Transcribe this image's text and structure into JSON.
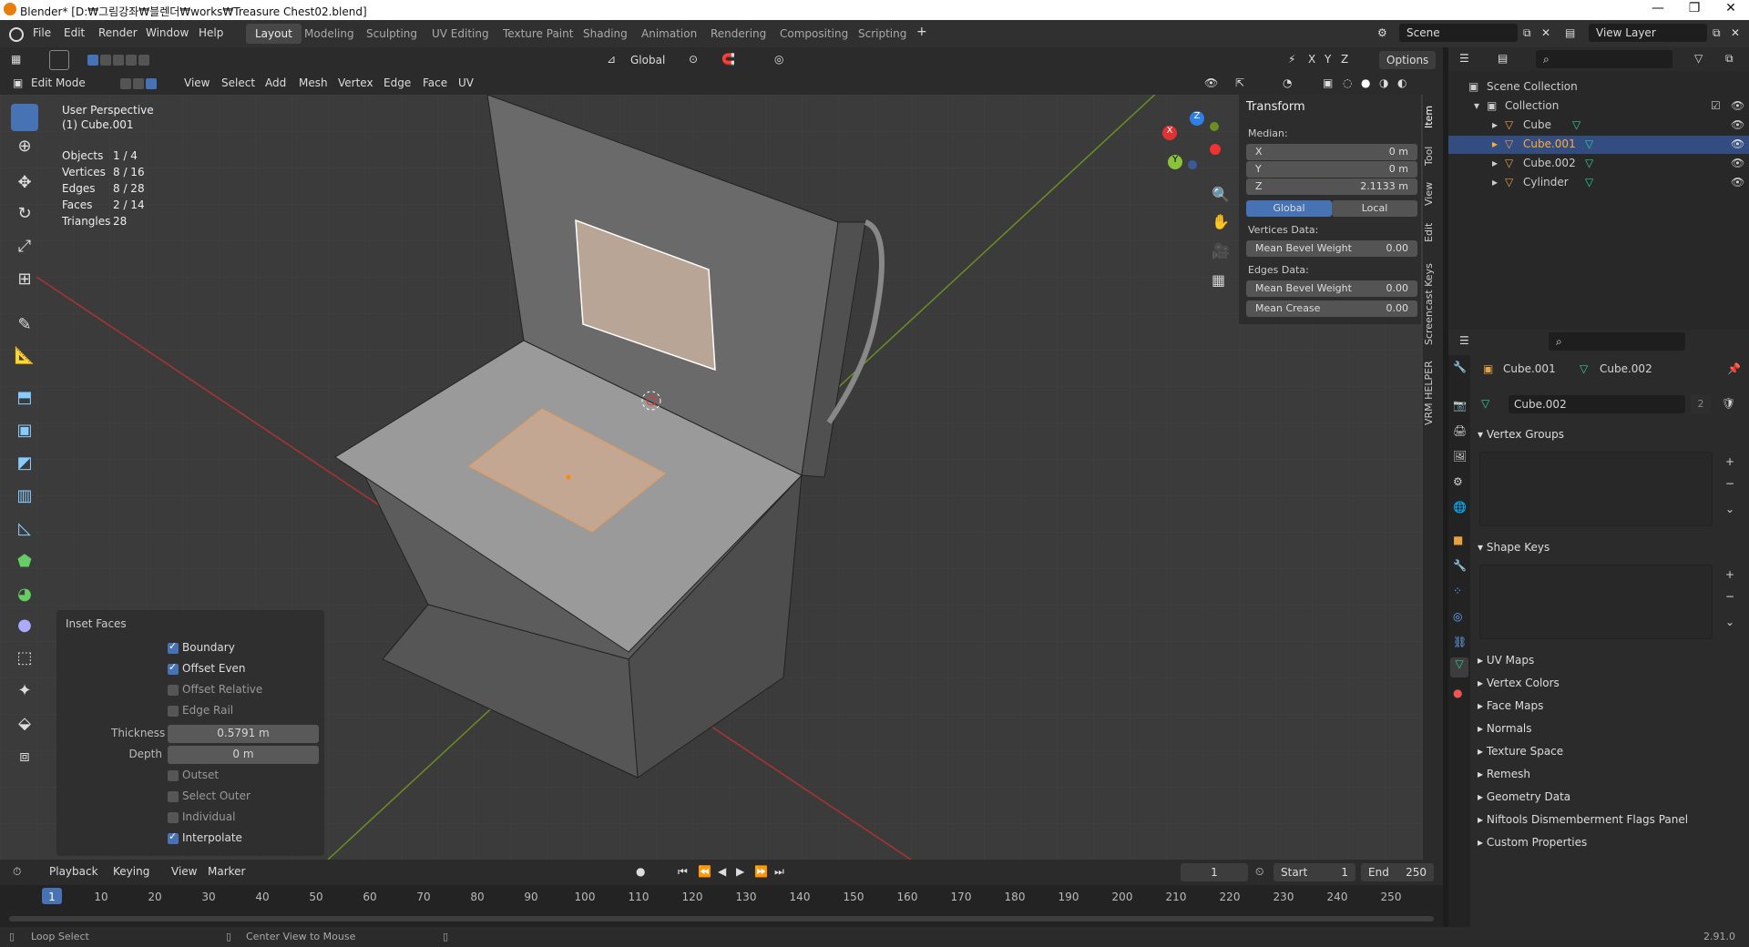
{
  "app": {
    "title": "Blender* [D:₩그림강좌₩블렌더₩works₩Treasure Chest02.blend]",
    "version": "2.91.0"
  },
  "menu": [
    "File",
    "Edit",
    "Render",
    "Window",
    "Help"
  ],
  "workspaces": [
    {
      "label": "Layout",
      "active": true
    },
    {
      "label": "Modeling"
    },
    {
      "label": "Sculpting"
    },
    {
      "label": "UV Editing"
    },
    {
      "label": "Texture Paint"
    },
    {
      "label": "Shading"
    },
    {
      "label": "Animation"
    },
    {
      "label": "Rendering"
    },
    {
      "label": "Compositing"
    },
    {
      "label": "Scripting"
    }
  ],
  "scene": {
    "scene_name": "Scene",
    "view_layer": "View Layer"
  },
  "viewport_header": {
    "mode": "Edit Mode",
    "menus": [
      "View",
      "Select",
      "Add",
      "Mesh",
      "Vertex",
      "Edge",
      "Face",
      "UV"
    ],
    "orientation": "Global",
    "axes": [
      "X",
      "Y",
      "Z"
    ],
    "options_label": "Options"
  },
  "overlay_text": {
    "view_name": "User Perspective",
    "object_name": "(1) Cube.001",
    "stats": [
      {
        "label": "Objects",
        "value": "1 / 4"
      },
      {
        "label": "Vertices",
        "value": "8 / 16"
      },
      {
        "label": "Edges",
        "value": "8 / 28"
      },
      {
        "label": "Faces",
        "value": "2 / 14"
      },
      {
        "label": "Triangles",
        "value": "28"
      }
    ]
  },
  "gizmo": {
    "x": "X",
    "y": "Y",
    "z": "Z"
  },
  "n_panel": {
    "title": "Transform",
    "median_label": "Median:",
    "x": {
      "label": "X",
      "value": "0 m"
    },
    "y": {
      "label": "Y",
      "value": "0 m"
    },
    "z": {
      "label": "Z",
      "value": "2.1133 m"
    },
    "global_label": "Global",
    "local_label": "Local",
    "vertices_data_label": "Vertices Data:",
    "mean_bevel_weight_v": {
      "label": "Mean Bevel Weight",
      "value": "0.00"
    },
    "edges_data_label": "Edges Data:",
    "mean_bevel_weight_e": {
      "label": "Mean Bevel Weight",
      "value": "0.00"
    },
    "mean_crease": {
      "label": "Mean Crease",
      "value": "0.00"
    }
  },
  "side_tabs": [
    "Item",
    "Tool",
    "View",
    "Edit",
    "Screencast Keys",
    "VRM HELPER"
  ],
  "inset_faces": {
    "title": "Inset Faces",
    "boundary": {
      "label": "Boundary",
      "checked": true
    },
    "offset_even": {
      "label": "Offset Even",
      "checked": true
    },
    "offset_relative": {
      "label": "Offset Relative",
      "checked": false
    },
    "edge_rail": {
      "label": "Edge Rail",
      "checked": false
    },
    "thickness": {
      "label": "Thickness",
      "value": "0.5791 m"
    },
    "depth": {
      "label": "Depth",
      "value": "0 m"
    },
    "outset": {
      "label": "Outset",
      "checked": false
    },
    "select_outer": {
      "label": "Select Outer",
      "checked": false
    },
    "individual": {
      "label": "Individual",
      "checked": false
    },
    "interpolate": {
      "label": "Interpolate",
      "checked": true
    }
  },
  "outliner": {
    "root": "Scene Collection",
    "collection": "Collection",
    "items": [
      {
        "label": "Cube",
        "selected": false
      },
      {
        "label": "Cube.001",
        "selected": true
      },
      {
        "label": "Cube.002",
        "selected": false
      },
      {
        "label": "Cylinder",
        "selected": false
      }
    ]
  },
  "properties": {
    "object_name": "Cube.001",
    "mesh_name": "Cube.002",
    "mesh_field": "Cube.002",
    "users": "2",
    "vertex_groups": "Vertex Groups",
    "shape_keys": "Shape Keys",
    "sections": [
      "UV Maps",
      "Vertex Colors",
      "Face Maps",
      "Normals",
      "Texture Space",
      "Remesh",
      "Geometry Data",
      "Niftools Dismemberment Flags Panel",
      "Custom Properties"
    ]
  },
  "timeline": {
    "menus": [
      "Playback",
      "Keying",
      "View",
      "Marker"
    ],
    "current_frame": "1",
    "start_label": "Start",
    "start": "1",
    "end_label": "End",
    "end": "250",
    "ticks": [
      "1",
      "10",
      "20",
      "30",
      "40",
      "50",
      "60",
      "70",
      "80",
      "90",
      "100",
      "110",
      "120",
      "130",
      "140",
      "150",
      "160",
      "170",
      "180",
      "190",
      "200",
      "210",
      "220",
      "230",
      "240",
      "250"
    ]
  },
  "statusbar": {
    "left": "Loop Select",
    "middle": "Center View to Mouse"
  },
  "colors": {
    "accent": "#4772b3",
    "selection": "#fdac3b",
    "header": "#303030",
    "viewport": "#3b3b3b"
  }
}
